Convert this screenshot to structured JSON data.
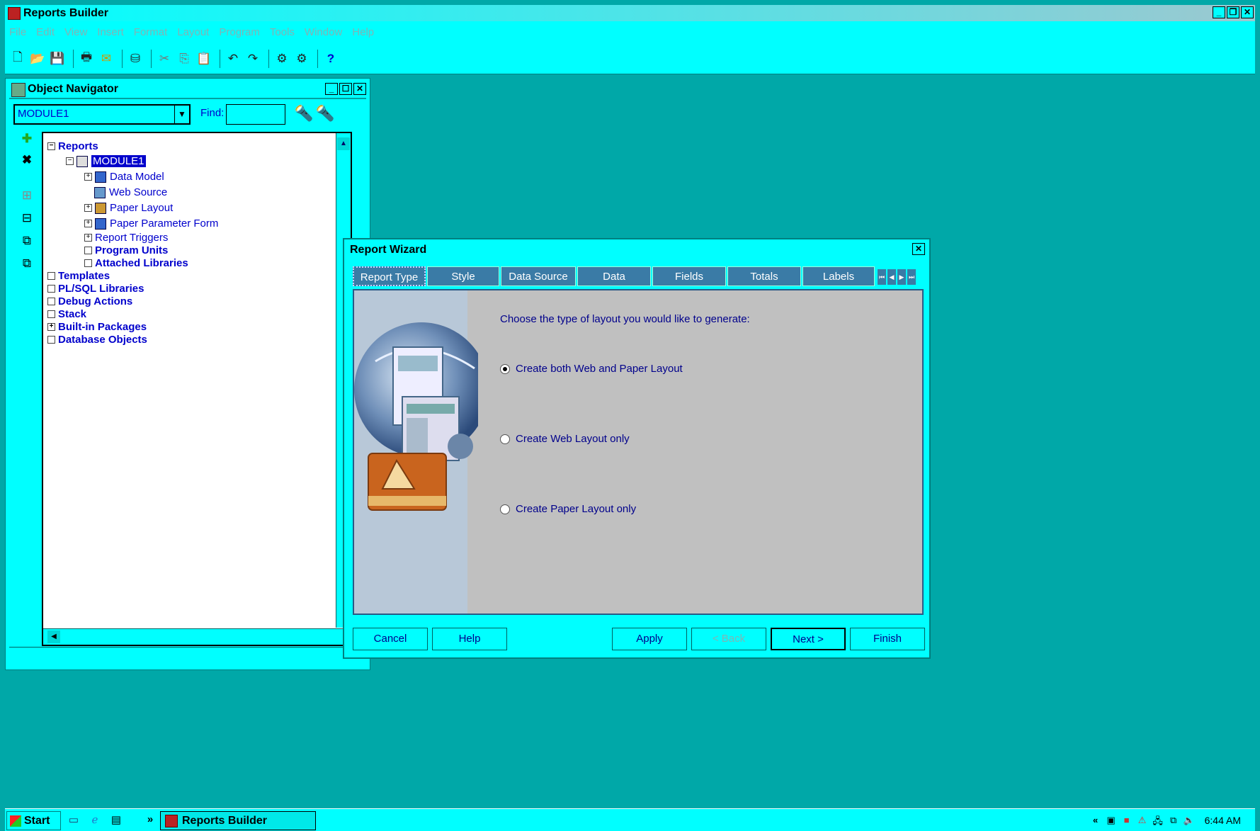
{
  "app": {
    "title": "Reports Builder"
  },
  "menu": [
    "File",
    "Edit",
    "View",
    "Insert",
    "Format",
    "Layout",
    "Program",
    "Tools",
    "Window",
    "Help"
  ],
  "toolbar": {
    "icons": [
      "new-icon",
      "open-icon",
      "save-icon",
      "print-icon",
      "mail-icon",
      "connect-icon",
      "cut-icon",
      "copy-icon",
      "paste-icon",
      "undo-icon",
      "redo-icon",
      "compile-icon",
      "run-icon",
      "help-icon"
    ]
  },
  "navigator": {
    "title": "Object Navigator",
    "module_select": "MODULE1",
    "find_label": "Find:",
    "find_value": "",
    "tree": {
      "reports": "Reports",
      "module": "MODULE1",
      "data_model": "Data Model",
      "web_source": "Web Source",
      "paper_layout": "Paper Layout",
      "paper_parameter_form": "Paper Parameter Form",
      "report_triggers": "Report Triggers",
      "program_units": "Program Units",
      "attached_libraries": "Attached Libraries",
      "templates": "Templates",
      "plsql_libraries": "PL/SQL Libraries",
      "debug_actions": "Debug Actions",
      "stack": "Stack",
      "builtin_packages": "Built-in Packages",
      "database_objects": "Database Objects"
    }
  },
  "wizard": {
    "title": "Report Wizard",
    "tabs": [
      "Report Type",
      "Style",
      "Data Source",
      "Data",
      "Fields",
      "Totals",
      "Labels"
    ],
    "active_tab": "Report Type",
    "prompt": "Choose the type of layout you would like to generate:",
    "options": [
      {
        "label": "Create both Web and Paper Layout",
        "selected": true
      },
      {
        "label": "Create Web Layout only",
        "selected": false
      },
      {
        "label": "Create Paper Layout only",
        "selected": false
      }
    ],
    "buttons": {
      "cancel": "Cancel",
      "help": "Help",
      "apply": "Apply",
      "back": "< Back",
      "next": "Next >",
      "finish": "Finish"
    }
  },
  "taskbar": {
    "start": "Start",
    "task": "Reports Builder",
    "clock": "6:44 AM"
  }
}
